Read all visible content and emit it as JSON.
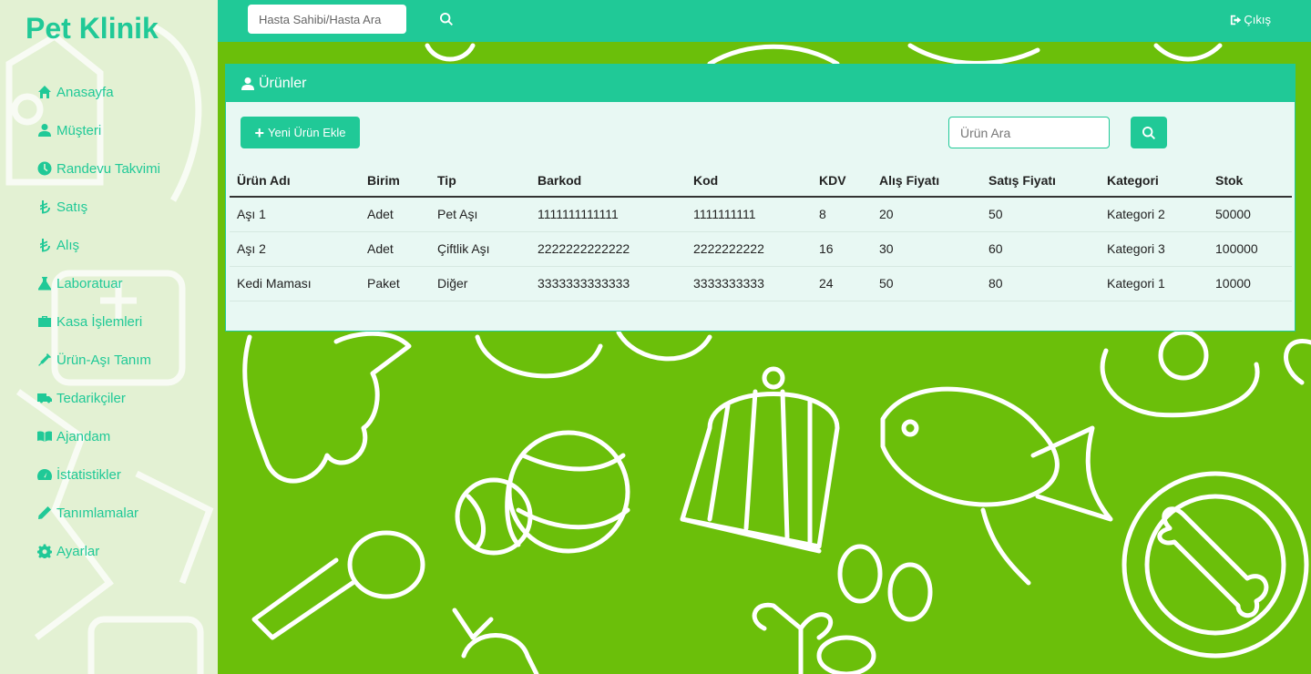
{
  "brand": "Pet Klinik",
  "nav": [
    {
      "label": "Anasayfa",
      "icon": "home-icon"
    },
    {
      "label": "Müşteri",
      "icon": "user-icon"
    },
    {
      "label": "Randevu Takvimi",
      "icon": "clock-icon"
    },
    {
      "label": "Satış",
      "icon": "lira-icon"
    },
    {
      "label": "Alış",
      "icon": "lira-icon"
    },
    {
      "label": "Laboratuar",
      "icon": "flask-icon"
    },
    {
      "label": "Kasa İşlemleri",
      "icon": "briefcase-icon"
    },
    {
      "label": "Ürün-Aşı Tanım",
      "icon": "syringe-icon"
    },
    {
      "label": "Tedarikçiler",
      "icon": "truck-icon"
    },
    {
      "label": "Ajandam",
      "icon": "book-icon"
    },
    {
      "label": "İstatistikler",
      "icon": "dashboard-icon"
    },
    {
      "label": "Tanımlamalar",
      "icon": "pencil-icon"
    },
    {
      "label": "Ayarlar",
      "icon": "gear-icon"
    }
  ],
  "topbar": {
    "search_placeholder": "Hasta Sahibi/Hasta Ara",
    "logout_label": "Çıkış"
  },
  "card": {
    "title": "Ürünler",
    "add_button": "Yeni Ürün Ekle",
    "search_placeholder": "Ürün Ara"
  },
  "table": {
    "columns": [
      "Ürün Adı",
      "Birim",
      "Tip",
      "Barkod",
      "Kod",
      "KDV",
      "Alış Fiyatı",
      "Satış Fiyatı",
      "Kategori",
      "Stok"
    ],
    "rows": [
      [
        "Aşı 1",
        "Adet",
        "Pet Aşı",
        "1111111111111",
        "1111111111",
        "8",
        "20",
        "50",
        "Kategori 2",
        "50000"
      ],
      [
        "Aşı 2",
        "Adet",
        "Çiftlik Aşı",
        "2222222222222",
        "2222222222",
        "16",
        "30",
        "60",
        "Kategori 3",
        "100000"
      ],
      [
        "Kedi Maması",
        "Paket",
        "Diğer",
        "3333333333333",
        "3333333333",
        "24",
        "50",
        "80",
        "Kategori 1",
        "10000"
      ]
    ]
  },
  "colors": {
    "accent": "#20c997",
    "background": "#6bbf0a",
    "sidebar": "#e3f1d3",
    "card": "#e8f8f3"
  }
}
